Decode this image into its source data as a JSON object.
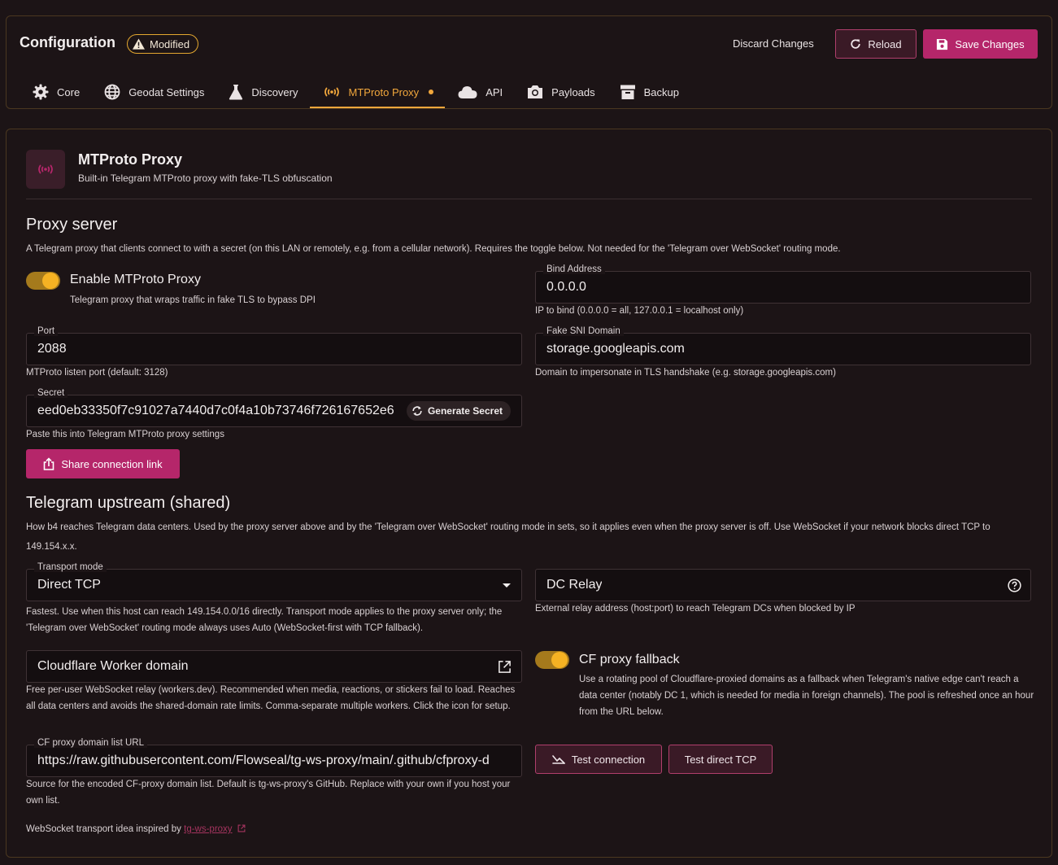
{
  "header": {
    "title": "Configuration",
    "badge": "Modified",
    "discard_label": "Discard Changes",
    "reload_label": "Reload",
    "save_label": "Save Changes"
  },
  "tabs": [
    {
      "label": "Core",
      "icon": "gear-icon"
    },
    {
      "label": "Geodat Settings",
      "icon": "globe-icon"
    },
    {
      "label": "Discovery",
      "icon": "flask-icon"
    },
    {
      "label": "MTProto Proxy",
      "icon": "broadcast-icon",
      "active": true
    },
    {
      "label": "API",
      "icon": "cloud-icon"
    },
    {
      "label": "Payloads",
      "icon": "camera-icon"
    },
    {
      "label": "Backup",
      "icon": "archive-icon"
    }
  ],
  "section_header": {
    "title": "MTProto Proxy",
    "subtitle": "Built-in Telegram MTProto proxy with fake-TLS obfuscation"
  },
  "proxy_server": {
    "title": "Proxy server",
    "description": "A Telegram proxy that clients connect to with a secret (on this LAN or remotely, e.g. from a cellular network). Requires the toggle below. Not needed for the 'Telegram over WebSocket' routing mode.",
    "enable_label": "Enable MTProto Proxy",
    "enable_helper": "Telegram proxy that wraps traffic in fake TLS to bypass DPI",
    "bind_label": "Bind Address",
    "bind_value": "0.0.0.0",
    "bind_helper": "IP to bind (0.0.0.0 = all, 127.0.0.1 = localhost only)",
    "port_label": "Port",
    "port_value": "2088",
    "port_helper": "MTProto listen port (default: 3128)",
    "sni_label": "Fake SNI Domain",
    "sni_value": "storage.googleapis.com",
    "sni_helper": "Domain to impersonate in TLS handshake (e.g. storage.googleapis.com)",
    "secret_label": "Secret",
    "secret_value": "eed0eb33350f7c91027a7440d7c0f4a10b73746f726167652e6",
    "generate_label": "Generate Secret",
    "secret_helper": "Paste this into Telegram MTProto proxy settings",
    "share_label": "Share connection link"
  },
  "upstream": {
    "title": "Telegram upstream (shared)",
    "description": "How b4 reaches Telegram data centers. Used by the proxy server above and by the 'Telegram over WebSocket' routing mode in sets, so it applies even when the proxy server is off. Use WebSocket if your network blocks direct TCP to 149.154.x.x.",
    "transport_label": "Transport mode",
    "transport_value": "Direct TCP",
    "transport_helper": "Fastest. Use when this host can reach 149.154.0.0/16 directly. Transport mode applies to the proxy server only; the 'Telegram over WebSocket' routing mode always uses Auto (WebSocket-first with TCP fallback).",
    "dc_relay_placeholder": "DC Relay",
    "dc_relay_helper": "External relay address (host:port) to reach Telegram DCs when blocked by IP",
    "cf_worker_placeholder": "Cloudflare Worker domain",
    "cf_worker_helper": "Free per-user WebSocket relay (workers.dev). Recommended when media, reactions, or stickers fail to load. Reaches all data centers and avoids the shared-domain rate limits. Comma-separate multiple workers. Click the icon for setup.",
    "cf_fallback_label": "CF proxy fallback",
    "cf_fallback_helper": "Use a rotating pool of Cloudflare-proxied domains as a fallback when Telegram's native edge can't reach a data center (notably DC 1, which is needed for media in foreign channels). The pool is refreshed once an hour from the URL below.",
    "cf_list_label": "CF proxy domain list URL",
    "cf_list_value": "https://raw.githubusercontent.com/Flowseal/tg-ws-proxy/main/.github/cfproxy-d",
    "cf_list_helper": "Source for the encoded CF-proxy domain list. Default is tg-ws-proxy's GitHub. Replace with your own if you host your own list.",
    "test_connection_label": "Test connection",
    "test_tcp_label": "Test direct TCP",
    "footer_prefix": "WebSocket transport idea inspired by ",
    "footer_link": "tg-ws-proxy"
  },
  "colors": {
    "accent": "#f1a73c",
    "primary": "#b5266a",
    "background": "#1c1416"
  }
}
